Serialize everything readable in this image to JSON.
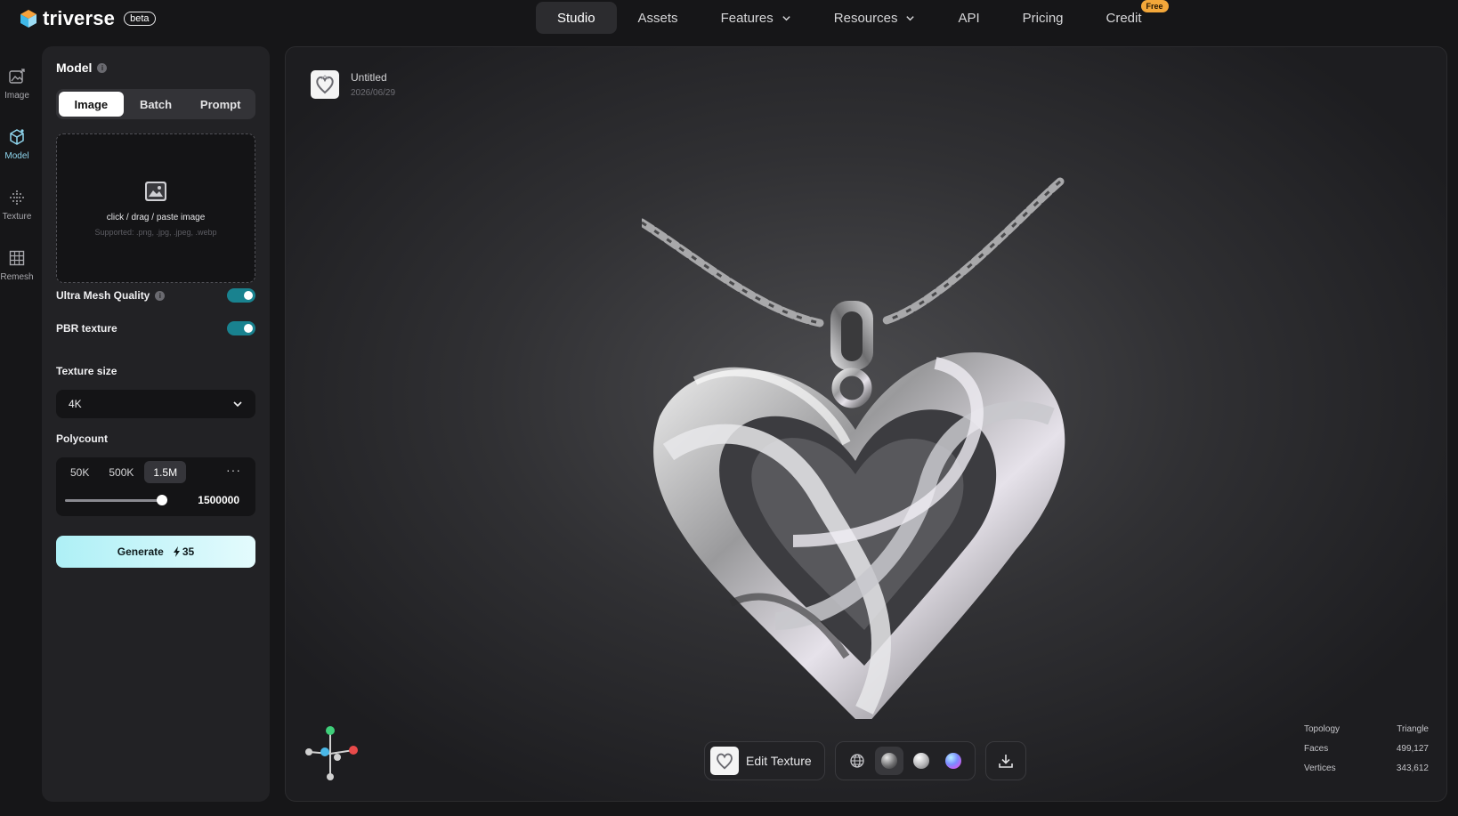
{
  "brand": {
    "name": "triverse",
    "badge": "beta"
  },
  "nav": {
    "items": [
      {
        "label": "Studio",
        "active": true
      },
      {
        "label": "Assets"
      },
      {
        "label": "Features",
        "dropdown": true
      },
      {
        "label": "Resources",
        "dropdown": true
      },
      {
        "label": "API"
      },
      {
        "label": "Pricing"
      },
      {
        "label": "Credit",
        "badge": "Free"
      }
    ]
  },
  "rail": {
    "items": [
      {
        "label": "Image",
        "icon": "image-icon"
      },
      {
        "label": "Model",
        "icon": "cube-icon",
        "active": true
      },
      {
        "label": "Texture",
        "icon": "texture-icon"
      },
      {
        "label": "Remesh",
        "icon": "grid-icon"
      }
    ]
  },
  "panel": {
    "title": "Model",
    "tabs": [
      {
        "label": "Image",
        "active": true
      },
      {
        "label": "Batch"
      },
      {
        "label": "Prompt"
      }
    ],
    "upload": {
      "text": "click / drag / paste image",
      "supported": "Supported: .png, .jpg, .jpeg, .webp"
    },
    "ultra_mesh": {
      "label": "Ultra Mesh Quality",
      "enabled": true
    },
    "pbr": {
      "label": "PBR texture",
      "enabled": true
    },
    "texture_size": {
      "label": "Texture size",
      "value": "4K"
    },
    "polycount": {
      "label": "Polycount",
      "options": [
        "50K",
        "500K",
        "1.5M"
      ],
      "selected": "1.5M",
      "more": "···",
      "value": "1500000",
      "slider_fraction": 0.96
    },
    "generate": {
      "label": "Generate",
      "cost": "35"
    }
  },
  "viewport": {
    "file": {
      "name": "Untitled",
      "date": "2026/06/29"
    },
    "edit_texture": "Edit Texture",
    "stats": [
      {
        "label": "Topology",
        "value": "Triangle"
      },
      {
        "label": "Faces",
        "value": "499,127"
      },
      {
        "label": "Vertices",
        "value": "343,612"
      }
    ]
  },
  "colors": {
    "accent": "#19828f",
    "background": "#161618",
    "panel": "#222225",
    "generate_gradient_start": "#aef0f6",
    "badge_free": "#f3a73a"
  }
}
